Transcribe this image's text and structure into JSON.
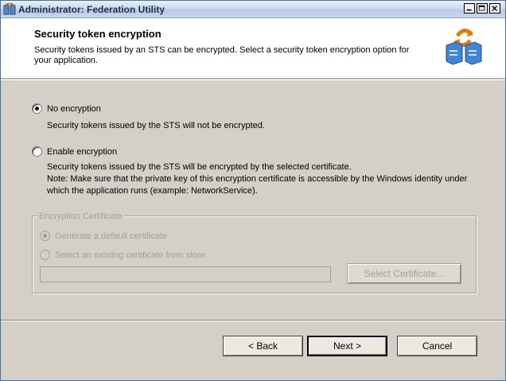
{
  "window": {
    "title": "Administrator: Federation Utility",
    "icon": "federation-app-icon",
    "caption_buttons": [
      "minimize",
      "maximize",
      "close"
    ]
  },
  "header": {
    "title": "Security token encryption",
    "description": "Security tokens issued by an STS can be encrypted. Select a security token encryption option for your application.",
    "icon": "federation-servers-icon"
  },
  "options": {
    "no_encryption": {
      "label": "No encryption",
      "description": "Security tokens issued by the STS will not be encrypted.",
      "selected": true
    },
    "enable_encryption": {
      "label": "Enable encryption",
      "description_line1": "Security tokens issued by the STS will be encrypted by the selected certificate.",
      "description_line2": "Note: Make sure that the private key of this encryption certificate is accessible by the Windows identity under",
      "description_line3": "which the application runs (example: NetworkService).",
      "selected": false
    }
  },
  "encryption_certificate": {
    "legend": "Encryption Certificate",
    "generate_default": "Generate a default certificate",
    "select_existing": "Select an existing certificate from store",
    "certificate_value": "",
    "select_button": "Select Certificate..."
  },
  "footer": {
    "back": "< Back",
    "next": "Next >",
    "cancel": "Cancel"
  },
  "colors": {
    "dialog_bg": "#d4d0c8",
    "header_bg": "#ffffff",
    "disabled_text": "#a0a0a0"
  }
}
